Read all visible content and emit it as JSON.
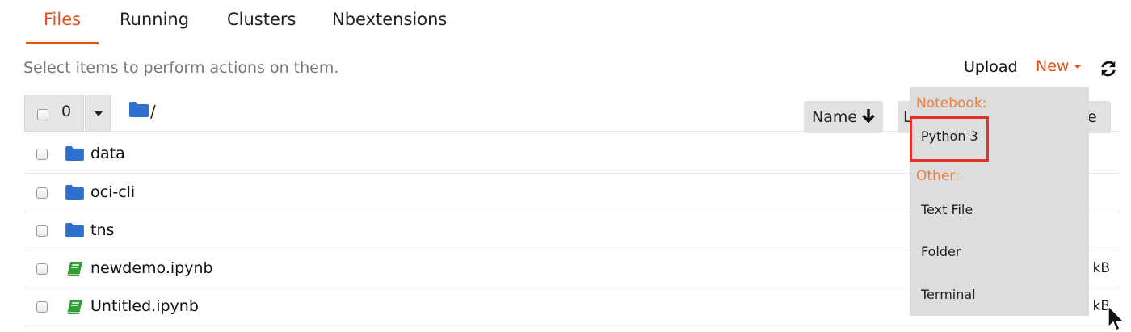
{
  "tabs": [
    {
      "label": "Files",
      "active": true
    },
    {
      "label": "Running",
      "active": false
    },
    {
      "label": "Clusters",
      "active": false
    },
    {
      "label": "Nbextensions",
      "active": false
    }
  ],
  "toolbar": {
    "hint": "Select items to perform actions on them.",
    "upload_label": "Upload",
    "new_label": "New",
    "refresh_icon": "refresh-icon"
  },
  "list_header": {
    "selected_count": "0",
    "path": "/",
    "sort_name_label": "Name",
    "sort_last_modified_label": "L",
    "sort_size_label": "e"
  },
  "files": [
    {
      "name": "data",
      "type": "folder",
      "size": ""
    },
    {
      "name": "oci-cli",
      "type": "folder",
      "size": ""
    },
    {
      "name": "tns",
      "type": "folder",
      "size": ""
    },
    {
      "name": "newdemo.ipynb",
      "type": "notebook",
      "size": "kB"
    },
    {
      "name": "Untitled.ipynb",
      "type": "notebook",
      "size": "kB"
    }
  ],
  "new_menu": {
    "notebook_header": "Notebook:",
    "notebook_items": [
      "Python 3"
    ],
    "other_header": "Other:",
    "other_items": [
      "Text File",
      "Folder",
      "Terminal"
    ]
  },
  "colors": {
    "accent": "#e2511b",
    "folder": "#2f6fd0",
    "notebook": "#2ea034",
    "menu_header": "#f07f3c",
    "highlight": "#e0332b"
  }
}
